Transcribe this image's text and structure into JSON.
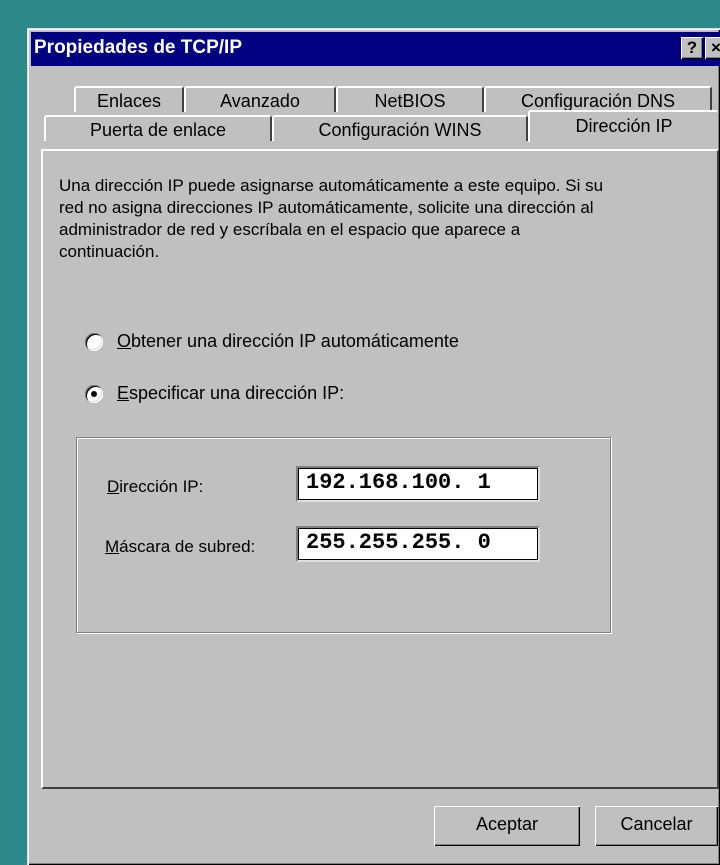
{
  "window": {
    "title": "Propiedades de TCP/IP",
    "help_label": "?",
    "close_label": "×"
  },
  "tabs_row1": [
    {
      "label": "Enlaces"
    },
    {
      "label": "Avanzado"
    },
    {
      "label": "NetBIOS"
    },
    {
      "label": "Configuración DNS"
    }
  ],
  "tabs_row2": [
    {
      "label": "Puerta de enlace"
    },
    {
      "label": "Configuración WINS"
    },
    {
      "label": "Dirección IP",
      "active": true
    }
  ],
  "description": "Una dirección IP puede asignarse automáticamente a este equipo. Si su red no asigna direcciones IP automáticamente, solicite una dirección al administrador de red y escríbala en el espacio que aparece a continuación.",
  "options": {
    "auto_key": "O",
    "auto_rest": "btener una dirección IP automáticamente",
    "auto_selected": false,
    "specify_key": "E",
    "specify_rest": "specificar una dirección IP:",
    "specify_selected": true
  },
  "fields": {
    "ip_key": "D",
    "ip_rest": "irección IP:",
    "ip_value": "192.168.100. 1",
    "mask_key": "M",
    "mask_rest": "áscara de subred:",
    "mask_value": "255.255.255. 0"
  },
  "buttons": {
    "ok": "Aceptar",
    "cancel": "Cancelar"
  }
}
